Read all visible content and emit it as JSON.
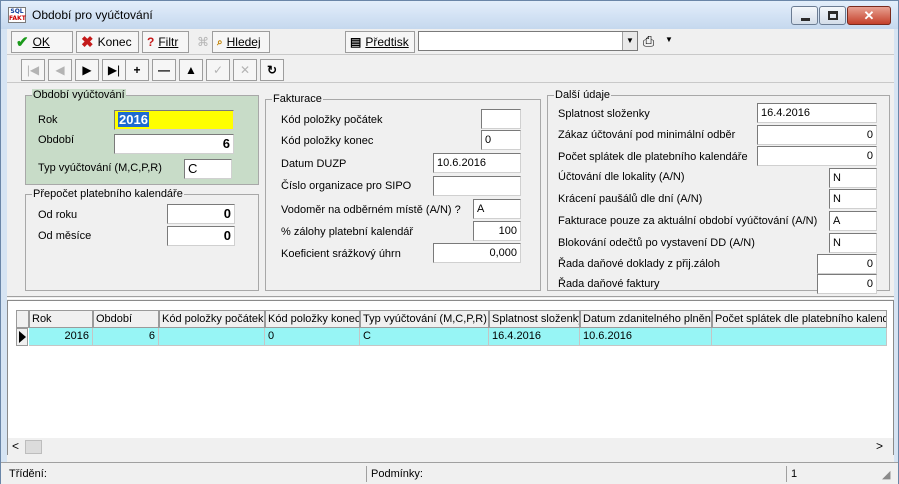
{
  "window": {
    "title": "Období pro vyúčtování",
    "icon_text_top": "SQL",
    "icon_text_bottom": "FAKT",
    "close_glyph": "✕"
  },
  "toolbar": {
    "ok_label": "OK",
    "ok_key": "O",
    "close_label": "Konec",
    "filter_label": "Filtr",
    "filter_key": "F",
    "search_label": "Hledej",
    "search_key": "H",
    "preview_label": "Předtisk",
    "preview_key": "P",
    "template_value": ""
  },
  "nav": {
    "first": "|◀",
    "prev": "◀",
    "next": "▶",
    "last": "▶|",
    "add": "+",
    "delete": "—",
    "up": "▲",
    "confirm": "✓",
    "cancel": "✕",
    "refresh": "↻"
  },
  "period": {
    "title": "Období vyúčtování",
    "rok_label": "Rok",
    "rok_value": "2016",
    "obdobi_label": "Období",
    "obdobi_value": "6",
    "typ_label": "Typ vyúčtování (M,C,P,R)",
    "typ_value": "C"
  },
  "recalc": {
    "title": "Přepočet platebního kalendáře",
    "od_roku_label": "Od roku",
    "od_roku_value": "0",
    "od_mesice_label": "Od měsíce",
    "od_mesice_value": "0"
  },
  "billing": {
    "title": "Fakturace",
    "kod_pocatek_label": "Kód položky počátek",
    "kod_pocatek_value": "",
    "kod_konec_label": "Kód položky konec",
    "kod_konec_value": "0",
    "duzp_label": "Datum DUZP",
    "duzp_value": "10.6.2016",
    "sipo_label": "Číslo organizace pro SIPO",
    "sipo_value": "",
    "vodomer_label": "Vodoměr na odběrném místě  (A/N) ?",
    "vodomer_value": "A",
    "zalohy_label": "% zálohy platební kalendář",
    "zalohy_value": "100",
    "koef_label": "Koeficient srážkový úhrn",
    "koef_value": "0,000"
  },
  "other": {
    "title": "Další údaje",
    "splatnost_label": "Splatnost složenky",
    "splatnost_value": "16.4.2016",
    "zakaz_label": "Zákaz účtování pod minimální odběr",
    "zakaz_value": "0",
    "pocet_splatek_label": "Počet splátek dle platebního kalendáře",
    "pocet_splatek_value": "0",
    "uctovani_lokality_label": "Účtování dle lokality (A/N)",
    "uctovani_lokality_value": "N",
    "kraceni_label": "Krácení paušálů dle dní (A/N)",
    "kraceni_value": "N",
    "fakturace_pouze_label": "Fakturace pouze za aktuální období vyúčtování (A/N)",
    "fakturace_pouze_value": "A",
    "blokovani_label": "Blokování odečtů po vystavení DD (A/N)",
    "blokovani_value": "N",
    "rada_dd_label": "Řada daňové doklady z přij.záloh",
    "rada_dd_value": "0",
    "rada_df_label": "Řada daňové faktury",
    "rada_df_value": "0"
  },
  "grid": {
    "columns": [
      "Rok",
      "Období",
      "Kód položky počátek",
      "Kód položky konec",
      "Typ vyúčtování (M,C,P,R)",
      "Splatnost složenky",
      "Datum zdanitelného plnění",
      "Počet splátek dle platebního kalendá"
    ],
    "row": [
      "2016",
      "6",
      "",
      "0",
      "C",
      "16.4.2016",
      "10.6.2016",
      ""
    ],
    "scroll_left": "<",
    "scroll_right": ">"
  },
  "status": {
    "sort_label": "Třídění:",
    "cond_label": "Podmínky:",
    "count": "1"
  }
}
